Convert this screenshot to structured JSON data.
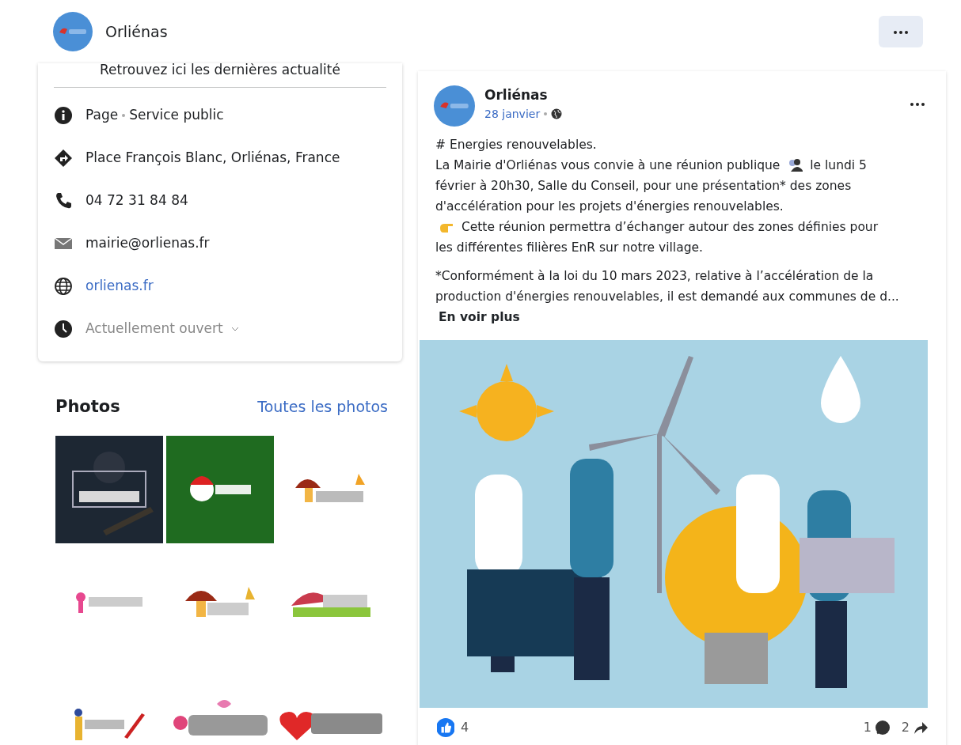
{
  "header": {
    "title": "Orliénas"
  },
  "about": {
    "intro": "Retrouvez ici les dernières actualité",
    "items": [
      {
        "kind": "info",
        "parts": [
          "Page",
          "Service public"
        ]
      },
      {
        "kind": "address",
        "parts": [
          "Place François Blanc, Orliénas, France"
        ]
      },
      {
        "kind": "phone",
        "parts": [
          "04 72 31 84 84"
        ]
      },
      {
        "kind": "email",
        "parts": [
          "mairie@orlienas.fr"
        ]
      },
      {
        "kind": "website",
        "parts": [
          "orlienas.fr"
        ]
      },
      {
        "kind": "hours",
        "parts": [
          "Actuellement ouvert"
        ]
      }
    ]
  },
  "photos": {
    "title": "Photos",
    "link": "Toutes les photos",
    "items": [
      {
        "kind": "picture"
      },
      {
        "kind": "picture"
      },
      {
        "kind": "picture"
      },
      {
        "kind": "picture"
      },
      {
        "kind": "picture"
      },
      {
        "kind": "picture"
      },
      {
        "kind": "picture"
      },
      {
        "kind": "picture"
      },
      {
        "kind": "picture"
      }
    ]
  },
  "post": {
    "author": "Orliénas",
    "date": "28 janvier",
    "paragraphs": [
      [
        [
          {
            "kind": "text",
            "text": "# Energies renouvelables."
          }
        ]
      ],
      [
        [
          {
            "kind": "text",
            "text": "La Mairie d'Orliénas vous convie à une réunion publique"
          },
          {
            "kind": "people"
          },
          {
            "kind": "text",
            "text": "le lundi 5"
          }
        ],
        [
          {
            "kind": "text",
            "text": "février à 20h30, Salle du Conseil, pour une présentation* des zones d'accélération pour les projets d'énergies renouvelables."
          }
        ]
      ],
      [
        [
          {
            "kind": "pointing"
          },
          {
            "kind": "text",
            "text": "Cette réunion permettra d’échanger autour des zones définies pour"
          }
        ],
        [
          {
            "kind": "text",
            "text": "les différentes filières EnR sur notre village."
          }
        ]
      ],
      [
        [
          {
            "kind": "text",
            "text": "*Conformément à la loi du 10 mars 2023, relative à l’accélération de la production d'énergies renouvelables, il est demandé aux communes de d..."
          },
          {
            "kind": "more",
            "text": "En voir plus"
          }
        ]
      ]
    ],
    "image": {
      "kind": "picture"
    },
    "likes": "4",
    "comments": "1",
    "shares": "2"
  }
}
